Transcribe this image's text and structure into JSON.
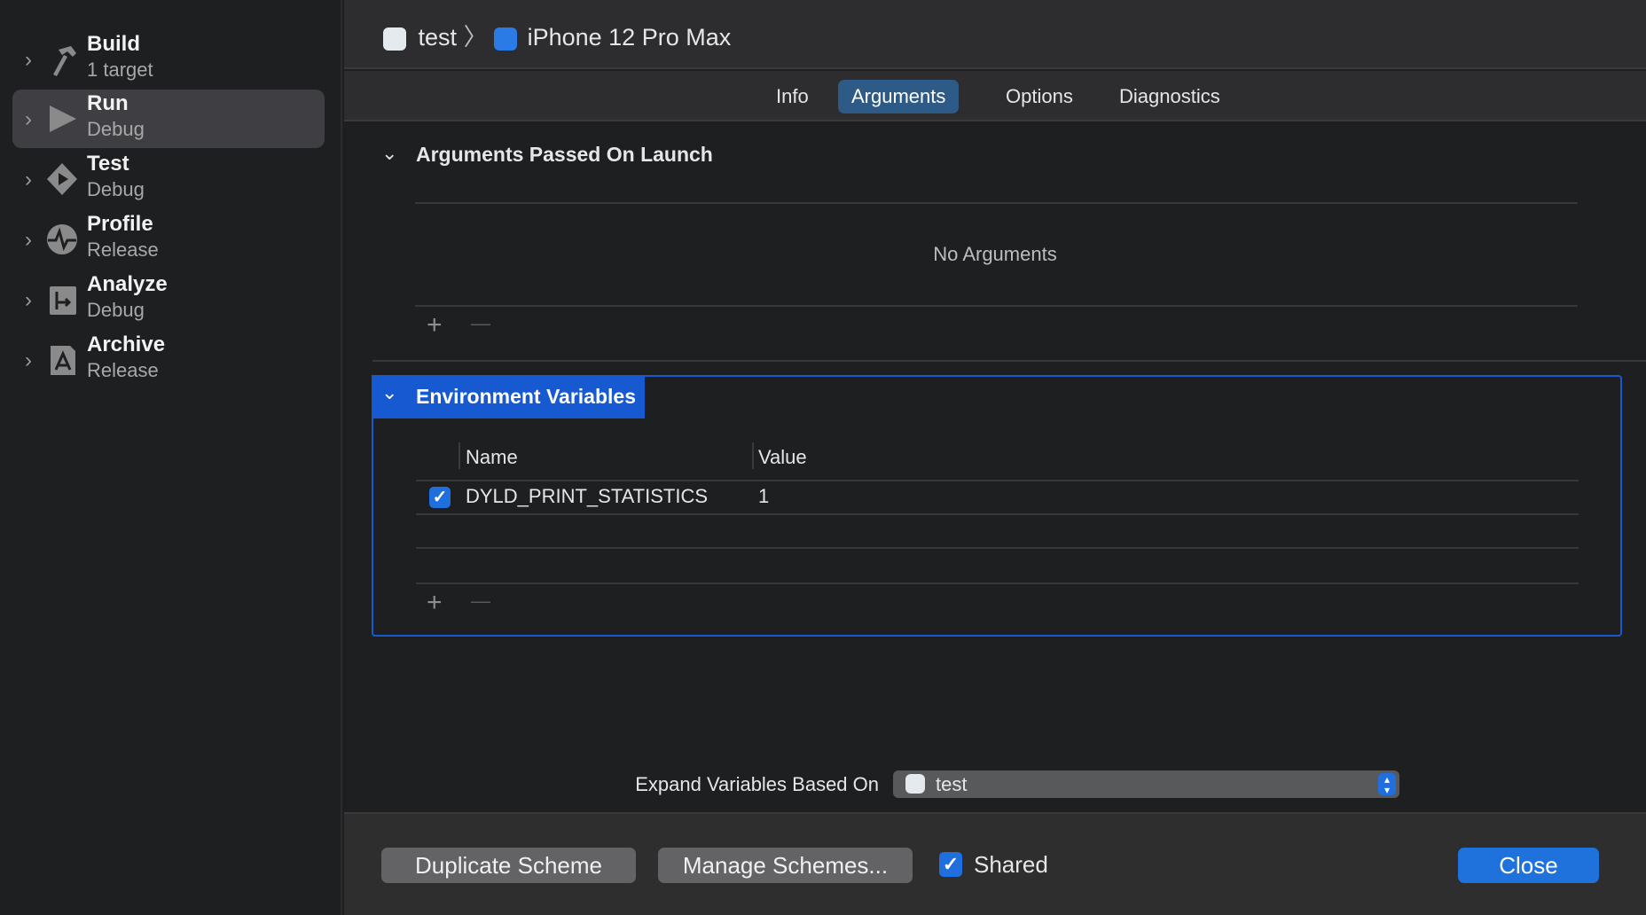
{
  "sidebar": {
    "items": [
      {
        "title": "Build",
        "subtitle": "1 target",
        "icon": "hammer-icon"
      },
      {
        "title": "Run",
        "subtitle": "Debug",
        "icon": "play-icon",
        "selected": true
      },
      {
        "title": "Test",
        "subtitle": "Debug",
        "icon": "test-diamond-icon"
      },
      {
        "title": "Profile",
        "subtitle": "Release",
        "icon": "waveform-icon"
      },
      {
        "title": "Analyze",
        "subtitle": "Debug",
        "icon": "analyze-icon"
      },
      {
        "title": "Archive",
        "subtitle": "Release",
        "icon": "archive-icon"
      }
    ]
  },
  "header": {
    "scheme": "test",
    "separator": "〉",
    "destination": "iPhone 12 Pro Max"
  },
  "tabs": [
    {
      "label": "Info"
    },
    {
      "label": "Arguments",
      "selected": true
    },
    {
      "label": "Options"
    },
    {
      "label": "Diagnostics"
    }
  ],
  "arguments": {
    "title": "Arguments Passed On Launch",
    "empty": "No Arguments",
    "add": "+",
    "remove": "—"
  },
  "env": {
    "title": "Environment Variables",
    "col_name": "Name",
    "col_value": "Value",
    "rows": [
      {
        "checked": true,
        "name": "DYLD_PRINT_STATISTICS",
        "value": "1"
      }
    ],
    "add": "+",
    "remove": "—"
  },
  "expand": {
    "label": "Expand Variables Based On",
    "value": "test"
  },
  "footer": {
    "duplicate": "Duplicate Scheme",
    "manage": "Manage Schemes...",
    "shared_label": "Shared",
    "shared": true,
    "close": "Close"
  },
  "colors": {
    "accent": "#1f6fdf",
    "selected_tab": "#2e5a87",
    "env_header": "#1659d1"
  }
}
